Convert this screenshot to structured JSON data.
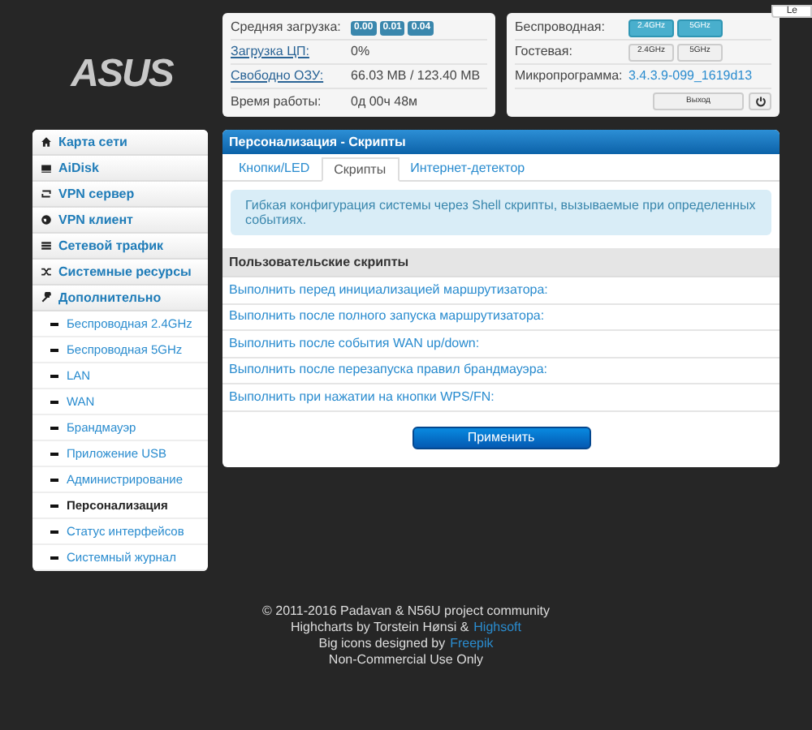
{
  "logo": {
    "text": "ASUS"
  },
  "corner_button": {
    "label": "Le"
  },
  "status": [
    {
      "label": "Средняя загрузка:",
      "link": false,
      "kind": "badges",
      "badges": [
        "0.00",
        "0.01",
        "0.04"
      ]
    },
    {
      "label": "Загрузка ЦП:",
      "link": true,
      "kind": "text",
      "value": "0%"
    },
    {
      "label": "Свободно ОЗУ:",
      "link": true,
      "kind": "text",
      "value": "66.03 MB / 123.40 MB"
    },
    {
      "label": "Время работы:",
      "link": false,
      "kind": "text",
      "value": "0д 00ч 48м"
    }
  ],
  "wireless": [
    {
      "label": "Беспроводная:",
      "kind": "bands",
      "bands": [
        {
          "label": "2.4GHz",
          "on": true
        },
        {
          "label": "5GHz",
          "on": true
        }
      ]
    },
    {
      "label": "Гостевая:",
      "kind": "bands",
      "bands": [
        {
          "label": "2.4GHz",
          "on": false
        },
        {
          "label": "5GHz",
          "on": false
        }
      ]
    },
    {
      "label": "Микропрограмма:",
      "kind": "link",
      "value": "3.4.3.9-099_1619d13"
    },
    {
      "kind": "buttons",
      "logout": "Выход"
    }
  ],
  "sidebar": {
    "items": [
      {
        "label": "Карта сети",
        "selected": false
      },
      {
        "label": "AiDisk",
        "selected": false
      },
      {
        "label": "VPN сервер",
        "selected": false
      },
      {
        "label": "VPN клиент",
        "selected": false
      },
      {
        "label": "Сетевой трафик",
        "selected": false
      },
      {
        "label": "Системные ресурсы",
        "selected": false
      },
      {
        "label": "Дополнительно",
        "selected": false,
        "children": [
          {
            "label": "Беспроводная 2.4GHz",
            "selected": false
          },
          {
            "label": "Беспроводная 5GHz",
            "selected": false
          },
          {
            "label": "LAN",
            "selected": false
          },
          {
            "label": "WAN",
            "selected": false
          },
          {
            "label": "Брандмауэр",
            "selected": false
          },
          {
            "label": "Приложение USB",
            "selected": false
          },
          {
            "label": "Администрирование",
            "selected": false
          },
          {
            "label": "Персонализация",
            "selected": true
          },
          {
            "label": "Статус интерфейсов",
            "selected": false
          },
          {
            "label": "Системный журнал",
            "selected": false
          }
        ]
      }
    ]
  },
  "panel": {
    "title": "Персонализация - Скрипты",
    "tabs": [
      {
        "label": "Кнопки/LED",
        "selected": false
      },
      {
        "label": "Скрипты",
        "selected": true
      },
      {
        "label": "Интернет-детектор",
        "selected": false
      }
    ],
    "info": "Гибкая конфигурация системы через Shell скрипты, вызываемые при определенных событиях.",
    "section_title": "Пользовательские скрипты",
    "scripts": [
      "Выполнить перед инициализацией маршрутизатора:",
      "Выполнить после полного запуска маршрутизатора:",
      "Выполнить после события WAN up/down:",
      "Выполнить после перезапуска правил брандмауэра:",
      "Выполнить при нажатии на кнопки WPS/FN:"
    ],
    "apply_button": "Применить"
  },
  "footer": [
    [
      {
        "text": "© 2011-2016 Padavan & N56U project community",
        "link": false
      }
    ],
    [
      {
        "text": "Highcharts by Torstein Hønsi &",
        "link": false
      },
      {
        "text": "Highsoft",
        "link": true
      }
    ],
    [
      {
        "text": "Big icons designed by",
        "link": false
      },
      {
        "text": "Freepik",
        "link": true
      }
    ],
    [
      {
        "text": "Non-Commercial Use Only",
        "link": false
      }
    ]
  ]
}
